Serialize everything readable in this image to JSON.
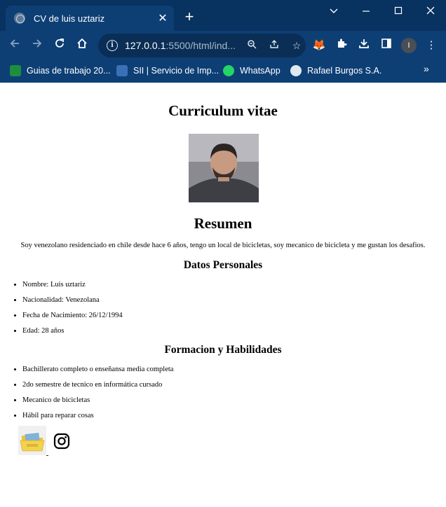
{
  "browser": {
    "tab_title": "CV de luis uztariz",
    "url_host": "127.0.0.1",
    "url_rest": ":5500/html/ind...",
    "bookmarks": [
      {
        "label": "Guias de trabajo 20...",
        "color": "#1e8e3e"
      },
      {
        "label": "SII | Servicio de Imp...",
        "color": "#3b6fb6"
      },
      {
        "label": "WhatsApp",
        "color": "#25d366"
      },
      {
        "label": "Rafael Burgos S.A.",
        "color": "#dfe8f2"
      }
    ],
    "profile_initial": "I"
  },
  "page": {
    "title": "Curriculum vitae",
    "summary_heading": "Resumen",
    "summary_text": "Soy venezolano residenciado en chile desde hace 6 años, tengo un local de bicicletas, soy mecanico de bicicleta y me gustan los desafios.",
    "personal_heading": "Datos Personales",
    "personal_items": [
      "Nombre: Luis uztariz",
      "Nacionalidad: Venezolana",
      "Fecha de Nacimiento: 26/12/1994",
      "Edad: 28 años"
    ],
    "skills_heading": "Formacion y Habilidades",
    "skills_items": [
      "Bachillerato completo o enseñansa media completa",
      "2do semestre de tecnico en informática cursado",
      "Mecanico de bicicletas",
      "Hábil para reparar cosas"
    ]
  },
  "colors": {
    "chrome_bg": "#0d3f75",
    "tabstrip_bg": "#08325f"
  }
}
